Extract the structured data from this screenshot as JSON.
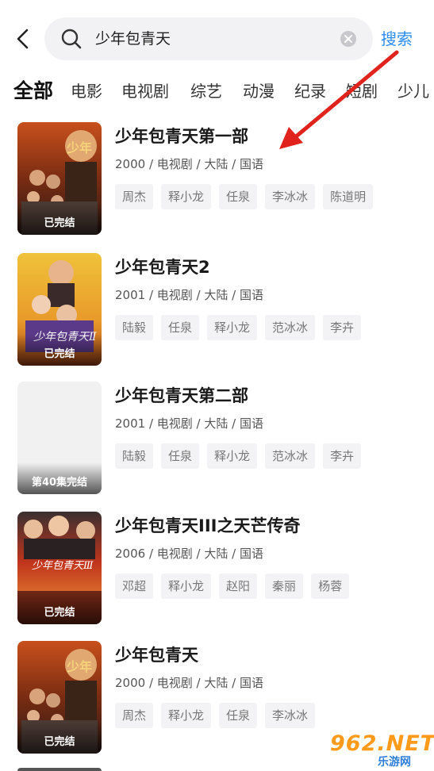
{
  "header": {
    "search_query": "少年包青天",
    "search_button": "搜索",
    "back_icon": "chevron-left-icon",
    "search_icon": "search-icon",
    "clear_icon": "clear-circle-icon"
  },
  "tabs": [
    {
      "label": "全部",
      "active": true
    },
    {
      "label": "电影",
      "active": false
    },
    {
      "label": "电视剧",
      "active": false
    },
    {
      "label": "综艺",
      "active": false
    },
    {
      "label": "动漫",
      "active": false
    },
    {
      "label": "纪录",
      "active": false
    },
    {
      "label": "短剧",
      "active": false
    },
    {
      "label": "少儿",
      "active": false
    }
  ],
  "results": [
    {
      "title": "少年包青天第一部",
      "meta": "2000 / 电视剧 / 大陆 / 国语",
      "status": "已完结",
      "cast": [
        "周杰",
        "释小龙",
        "任泉",
        "李冰冰",
        "陈道明"
      ]
    },
    {
      "title": "少年包青天2",
      "meta": "2001 / 电视剧 / 大陆 / 国语",
      "status": "已完结",
      "cast": [
        "陆毅",
        "任泉",
        "释小龙",
        "范冰冰",
        "李卉"
      ]
    },
    {
      "title": "少年包青天第二部",
      "meta": "2001 / 电视剧 / 大陆 / 国语",
      "status": "第40集完结",
      "cast": [
        "陆毅",
        "任泉",
        "释小龙",
        "范冰冰",
        "李卉"
      ]
    },
    {
      "title": "少年包青天III之天芒传奇",
      "meta": "2006 / 电视剧 / 大陆 / 国语",
      "status": "已完结",
      "cast": [
        "邓超",
        "释小龙",
        "赵阳",
        "秦丽",
        "杨蓉"
      ]
    },
    {
      "title": "少年包青天",
      "meta": "2000 / 电视剧 / 大陆 / 国语",
      "status": "已完结",
      "cast": [
        "周杰",
        "释小龙",
        "任泉",
        "李冰冰"
      ]
    }
  ],
  "watermark": {
    "main": "962.NET",
    "sub": "乐游网"
  },
  "colors": {
    "accent": "#2c8df3",
    "chip_bg": "#f3f3f5",
    "annotation_arrow": "#e0231c",
    "watermark": "#ff9a1a"
  }
}
